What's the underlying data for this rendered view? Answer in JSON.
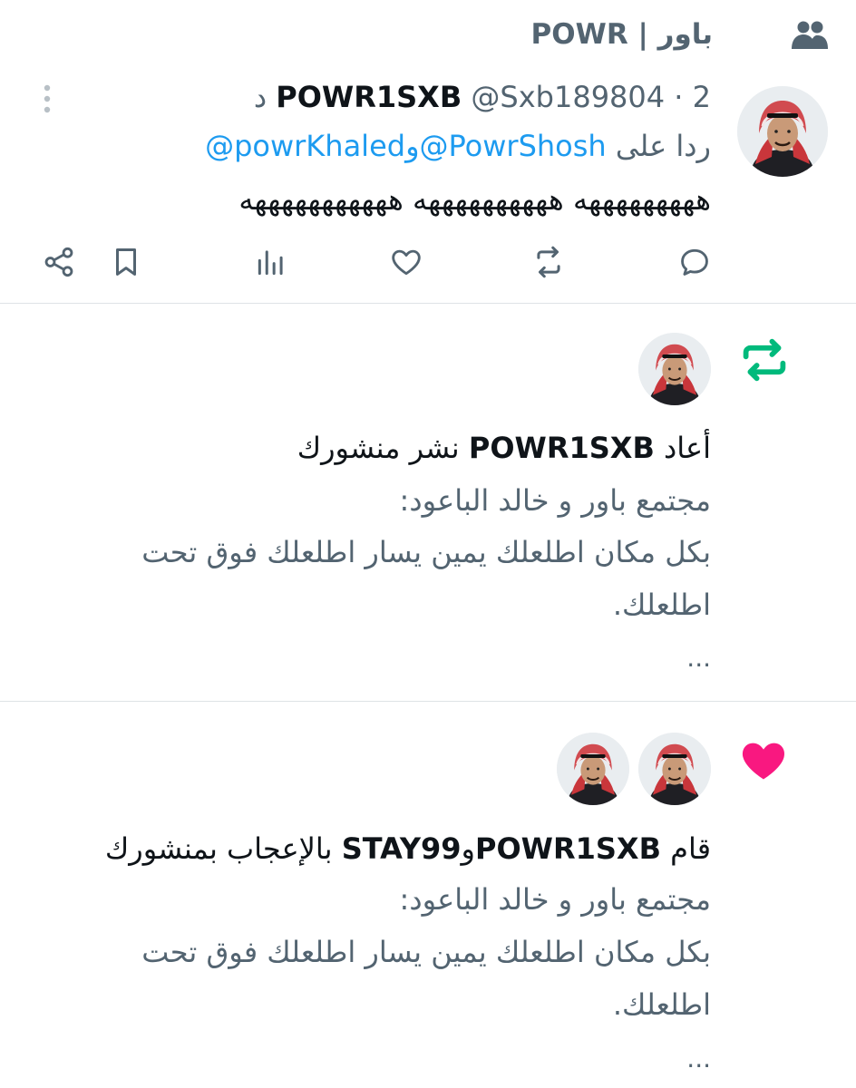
{
  "colors": {
    "text": "#0f1419",
    "muted": "#536471",
    "link": "#1d9bf0",
    "repost_green": "#00ba7c",
    "like_pink": "#f91880"
  },
  "community_header": {
    "label": "باور | POWR",
    "icon": "community-icon"
  },
  "reply_tweet": {
    "display_name": "POWR1SXB",
    "handle": "@Sxb189804",
    "time": "2 د",
    "separator": "·",
    "reply_prefix": "ردا على",
    "reply_mention_1": "@PowrShosh",
    "reply_joiner": "و",
    "reply_mention_2": "@powrKhaled",
    "text": "هههههههههه ههههههههههه هههههههههههه",
    "actions": [
      "reply-icon",
      "repost-icon",
      "like-icon",
      "views-icon",
      "bookmark-icon",
      "share-icon"
    ],
    "more_icon": "more-icon"
  },
  "repost_notification": {
    "icon": "repost-icon",
    "prefix": "أعاد",
    "user": "POWR1SXB",
    "suffix": "نشر منشورك",
    "preview_line_1": "مجتمع باور و خالد الباعود:",
    "preview_line_2": "بكل مكان اطلعلك يمين يسار اطلعلك فوق تحت",
    "preview_line_3": "اطلعلك.",
    "ellipsis": "..."
  },
  "like_notification": {
    "icon": "heart-filled-icon",
    "prefix": "قام",
    "user_1": "POWR1SXB",
    "joiner": "و",
    "user_2": "STAY99",
    "suffix": "بالإعجاب بمنشورك",
    "preview_line_1": "مجتمع باور و خالد الباعود:",
    "preview_line_2": "بكل مكان اطلعلك يمين يسار اطلعلك فوق تحت",
    "preview_line_3": "اطلعلك.",
    "ellipsis": "..."
  }
}
